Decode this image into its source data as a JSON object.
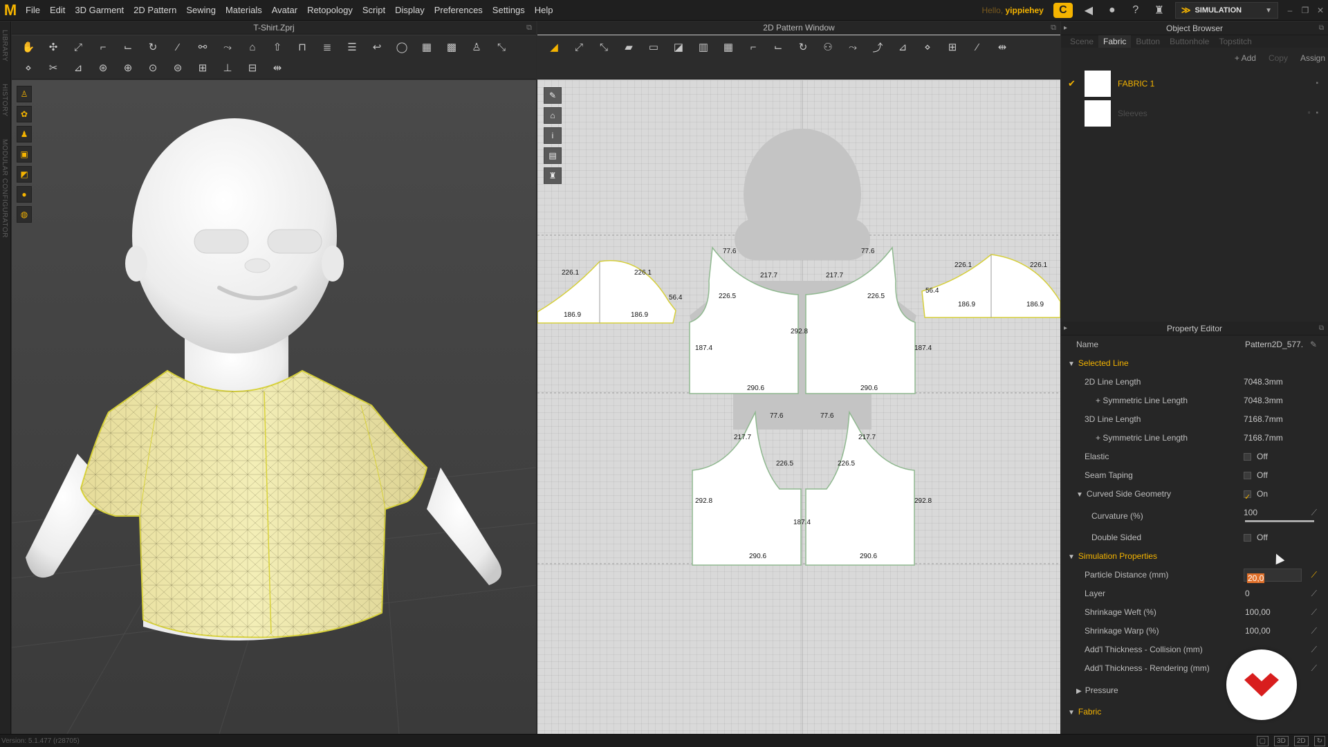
{
  "menubar": {
    "items": [
      "File",
      "Edit",
      "3D Garment",
      "2D Pattern",
      "Sewing",
      "Materials",
      "Avatar",
      "Retopology",
      "Script",
      "Display",
      "Preferences",
      "Settings",
      "Help"
    ],
    "hello_prefix": "Hello,",
    "username": "yippiehey",
    "mode_label": "SIMULATION"
  },
  "side_tabs": [
    "LIBRARY",
    "HISTORY",
    "MODULAR CONFIGURATOR"
  ],
  "window3d": {
    "title": "T-Shirt.Zprj"
  },
  "window2d": {
    "title": "2D Pattern Window",
    "measurements": {
      "sleeve_left": [
        "226.1",
        "226.1",
        "56.4",
        "186.9",
        "186.9"
      ],
      "sleeve_right": [
        "226.1",
        "226.1",
        "56.4",
        "186.9",
        "186.9"
      ],
      "back_left": [
        "77.6",
        "217.7",
        "226.5",
        "187.4",
        "290.6"
      ],
      "back_right": [
        "77.6",
        "217.7",
        "226.5",
        "187.4",
        "290.6"
      ],
      "back_center": "292.8",
      "front_left": [
        "77.6",
        "217.7",
        "226.5",
        "292.8",
        "290.6"
      ],
      "front_right": [
        "77.6",
        "217.7",
        "226.5",
        "292.8",
        "290.6"
      ],
      "front_center": "187.4"
    }
  },
  "object_browser": {
    "title": "Object Browser",
    "tabs": [
      "Scene",
      "Fabric",
      "Button",
      "Buttonhole",
      "Topstitch"
    ],
    "active_tab": "Fabric",
    "actions": {
      "add": "+ Add",
      "copy": "Copy",
      "assign": "Assign"
    },
    "fabrics": [
      {
        "name": "FABRIC 1",
        "selected": true
      },
      {
        "name": "Sleeves",
        "selected": false
      }
    ]
  },
  "property_editor": {
    "title": "Property Editor",
    "name_label": "Name",
    "name_value": "Pattern2D_577.",
    "selected_line": {
      "label": "Selected Line",
      "line_2d_label": "2D Line Length",
      "line_2d_value": "7048.3mm",
      "sym_2d_label": "+ Symmetric Line Length",
      "sym_2d_value": "7048.3mm",
      "line_3d_label": "3D Line Length",
      "line_3d_value": "7168.7mm",
      "sym_3d_label": "+ Symmetric Line Length",
      "sym_3d_value": "7168.7mm",
      "elastic_label": "Elastic",
      "elastic_value": "Off",
      "seam_label": "Seam Taping",
      "seam_value": "Off",
      "curved_label": "Curved Side Geometry",
      "curved_value": "On",
      "curvature_label": "Curvature (%)",
      "curvature_value": "100",
      "double_label": "Double Sided",
      "double_value": "Off"
    },
    "simulation": {
      "label": "Simulation Properties",
      "particle_label": "Particle Distance (mm)",
      "particle_value": "20,0",
      "layer_label": "Layer",
      "layer_value": "0",
      "weft_label": "Shrinkage Weft (%)",
      "weft_value": "100,00",
      "warp_label": "Shrinkage Warp (%)",
      "warp_value": "100,00",
      "collision_label": "Add'l Thickness - Collision (mm)",
      "rendering_label": "Add'l Thickness - Rendering (mm)"
    },
    "pressure_label": "Pressure",
    "fabric_label": "Fabric"
  },
  "status": {
    "version": "Version: 5.1.477 (r28705)"
  },
  "colors": {
    "accent": "#f5b400",
    "shirt": "#f2ecb0",
    "pattern_outline": "#d6cf3a"
  }
}
